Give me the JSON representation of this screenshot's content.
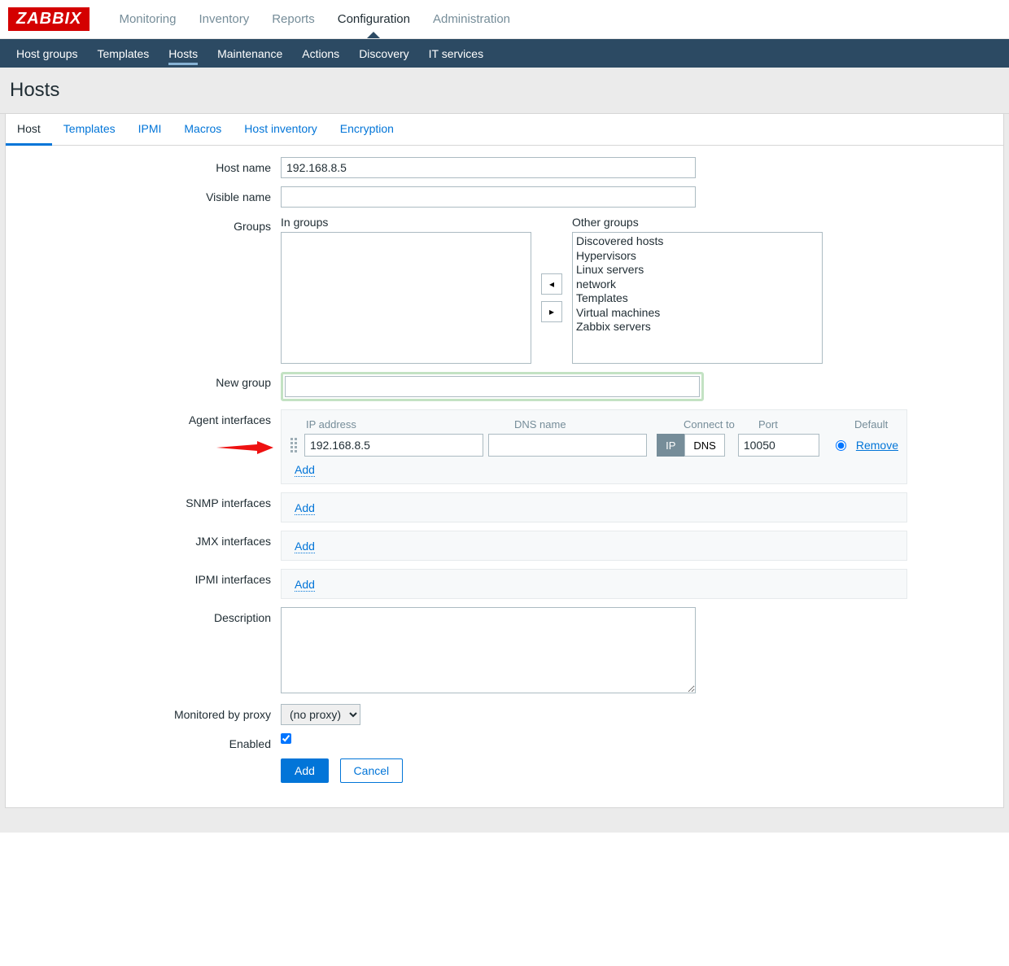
{
  "logo": "ZABBIX",
  "topnav": {
    "items": [
      "Monitoring",
      "Inventory",
      "Reports",
      "Configuration",
      "Administration"
    ],
    "active": "Configuration"
  },
  "subnav": {
    "items": [
      "Host groups",
      "Templates",
      "Hosts",
      "Maintenance",
      "Actions",
      "Discovery",
      "IT services"
    ],
    "active": "Hosts"
  },
  "page_title": "Hosts",
  "tabs": {
    "items": [
      "Host",
      "Templates",
      "IPMI",
      "Macros",
      "Host inventory",
      "Encryption"
    ],
    "active": "Host"
  },
  "labels": {
    "host_name": "Host name",
    "visible_name": "Visible name",
    "groups": "Groups",
    "in_groups": "In groups",
    "other_groups": "Other groups",
    "new_group": "New group",
    "agent_interfaces": "Agent interfaces",
    "snmp_interfaces": "SNMP interfaces",
    "jmx_interfaces": "JMX interfaces",
    "ipmi_interfaces": "IPMI interfaces",
    "description": "Description",
    "monitored_by_proxy": "Monitored by proxy",
    "enabled": "Enabled"
  },
  "interface_headers": {
    "ip": "IP address",
    "dns": "DNS name",
    "connect": "Connect to",
    "port": "Port",
    "default": "Default"
  },
  "values": {
    "host_name": "192.168.8.5",
    "visible_name": "",
    "new_group": "",
    "in_groups": [],
    "other_groups": [
      "Discovered hosts",
      "Hypervisors",
      "Linux servers",
      "network",
      "Templates",
      "Virtual machines",
      "Zabbix servers"
    ],
    "agent_ip": "192.168.8.5",
    "agent_dns": "",
    "agent_port": "10050",
    "connect_ip": "IP",
    "connect_dns": "DNS",
    "connect_active": "IP",
    "proxy": "(no proxy)",
    "description": "",
    "enabled": true,
    "default_radio": true
  },
  "actions": {
    "add_link": "Add",
    "remove": "Remove",
    "add_btn": "Add",
    "cancel_btn": "Cancel",
    "move_left": "◂",
    "move_right": "▸"
  }
}
